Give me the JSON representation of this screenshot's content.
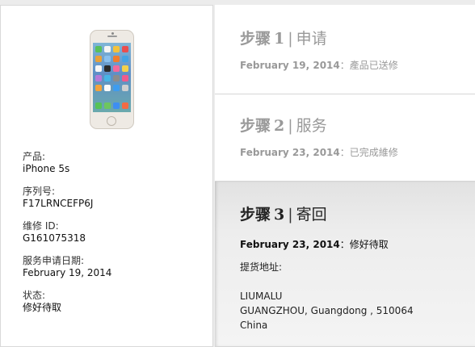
{
  "device": {
    "product_label": "产品:",
    "product_value": "iPhone 5s",
    "serial_label": "序列号:",
    "serial_value": "F17LRNCEFP6J",
    "repair_id_label": "维修 ID:",
    "repair_id_value": "G161075318",
    "request_date_label": "服务申请日期:",
    "request_date_value": "February 19, 2014",
    "status_label": "状态:",
    "status_value": "修好待取"
  },
  "steps": [
    {
      "prefix": "步骤",
      "number": "1",
      "separator": "|",
      "name": "申请",
      "date": "February 19, 2014",
      "status": "：產品已送修"
    },
    {
      "prefix": "步骤",
      "number": "2",
      "separator": "|",
      "name": "服务",
      "date": "February 23, 2014",
      "status": "：已完成維修"
    },
    {
      "prefix": "步骤",
      "number": "3",
      "separator": "|",
      "name": "寄回",
      "date": "February 23, 2014",
      "status": "：修好待取"
    }
  ],
  "pickup": {
    "label": "提货地址:",
    "line1": "LIUMALU",
    "line2": "GUANGZHOU, Guangdong , 510064",
    "line3": "China"
  },
  "colors": {
    "active_bg": "#ececec",
    "inactive_text": "#999999",
    "active_text": "#222222"
  }
}
